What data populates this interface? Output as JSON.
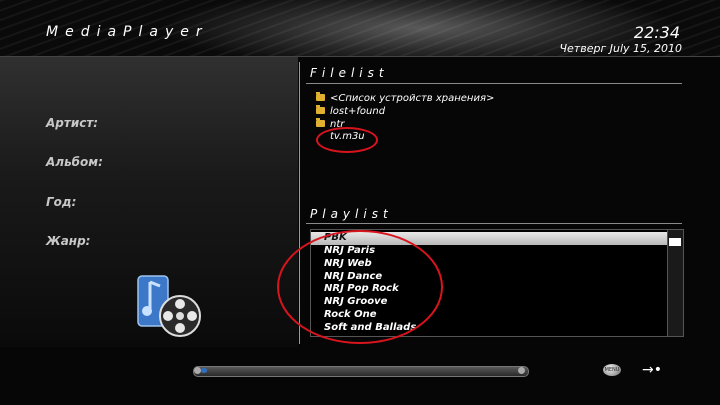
{
  "header": {
    "app_title": "MediaPlayer",
    "time": "22:34",
    "date": "Четверг July 15, 2010"
  },
  "metadata_labels": [
    "Артист:",
    "Альбом:",
    "Год:",
    "Жанр:"
  ],
  "filelist": {
    "title": "Filelist",
    "items": [
      {
        "label": "<Список устройств хранения>",
        "icon": "folder-icon"
      },
      {
        "label": "lost+found",
        "icon": "folder-icon"
      },
      {
        "label": "ntr",
        "icon": "folder-icon"
      },
      {
        "label": "tv.m3u",
        "icon": "none"
      }
    ]
  },
  "playlist": {
    "title": "Playlist",
    "items": [
      "PBK",
      "NRJ Paris",
      "NRJ Web",
      "NRJ Dance",
      "NRJ Pop Rock",
      "NRJ Groove",
      "Rock One",
      "Soft and Ballads"
    ],
    "selected_index": 0
  },
  "controls": {
    "menu_label": "MENU",
    "next_label": "→•"
  },
  "colors": {
    "annotation_red": "#d8141e",
    "folder_yellow": "#e0b030",
    "progress_blue": "#2e6fc0"
  }
}
